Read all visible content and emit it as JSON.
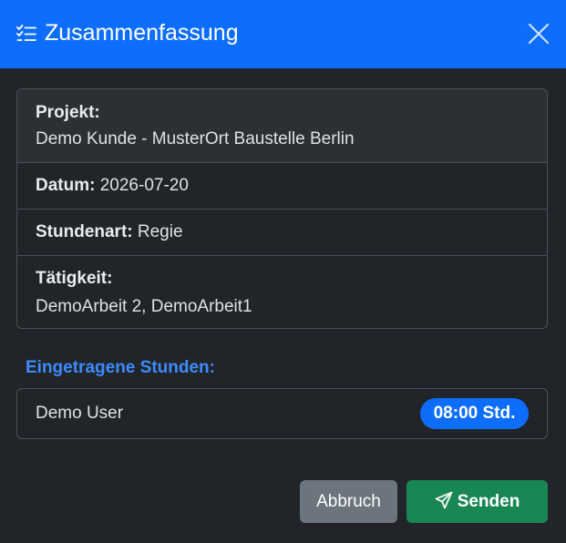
{
  "header": {
    "title": "Zusammenfassung",
    "icon": "list-check-icon",
    "close_icon": "close-icon",
    "background": "#0d6efd"
  },
  "summary": {
    "project_label": "Projekt:",
    "project_value": "Demo Kunde - MusterOrt Baustelle Berlin",
    "date_label": "Datum:",
    "date_value": "2026-07-20",
    "hour_type_label": "Stundenart:",
    "hour_type_value": "Regie",
    "activity_label": "Tätigkeit:",
    "activity_value": "DemoArbeit 2, DemoArbeit1"
  },
  "hours": {
    "section_title": "Eingetragene Stunden:",
    "entries": [
      {
        "user": "Demo User",
        "hours": "08:00 Std."
      }
    ]
  },
  "footer": {
    "cancel_label": "Abbruch",
    "send_label": "Senden",
    "send_icon": "send-icon",
    "cancel_color": "#6c757d",
    "send_color": "#198754"
  }
}
